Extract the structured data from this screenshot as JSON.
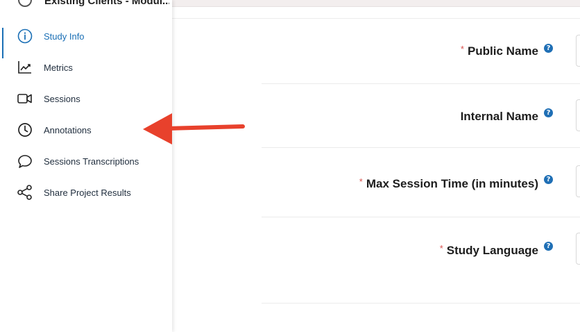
{
  "sidebar": {
    "header_title": "Existing Clients - Modul...",
    "items": [
      {
        "label": "Study Info",
        "icon": "info-circle-icon"
      },
      {
        "label": "Metrics",
        "icon": "chart-line-icon"
      },
      {
        "label": "Sessions",
        "icon": "video-camera-icon"
      },
      {
        "label": "Annotations",
        "icon": "clock-icon"
      },
      {
        "label": "Sessions Transcriptions",
        "icon": "speech-bubble-icon"
      },
      {
        "label": "Share Project Results",
        "icon": "share-icon"
      }
    ],
    "active_item": "Study Info"
  },
  "form": {
    "fields": [
      {
        "label": "Public Name",
        "required": true
      },
      {
        "label": "Internal Name",
        "required": false
      },
      {
        "label": "Max Session Time (in minutes)",
        "required": true
      },
      {
        "label": "Study Language",
        "required": true
      }
    ],
    "required_marker": "*",
    "help_glyph": "?"
  },
  "colors": {
    "accent": "#1a6fb5",
    "required": "#d9534f",
    "annotation_arrow": "#e8412c"
  }
}
